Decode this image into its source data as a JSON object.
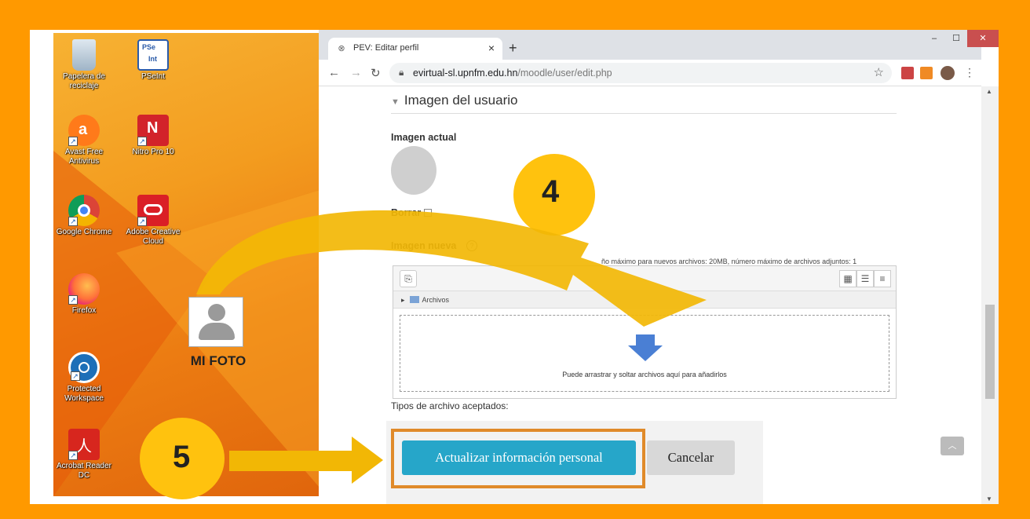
{
  "desktop": {
    "icons": [
      {
        "label": "Papelera de reciclaje",
        "icon": "recycle-bin-icon"
      },
      {
        "label": "PSeInt",
        "icon": "pseint-icon"
      },
      {
        "label": "Avast Free Antivirus",
        "icon": "avast-icon"
      },
      {
        "label": "Nitro Pro 10",
        "icon": "nitro-icon"
      },
      {
        "label": "Google Chrome",
        "icon": "chrome-icon"
      },
      {
        "label": "Adobe Creative Cloud",
        "icon": "creative-cloud-icon"
      },
      {
        "label": "Firefox",
        "icon": "firefox-icon"
      },
      {
        "label": "Protected Workspace",
        "icon": "protected-workspace-icon"
      },
      {
        "label": "Acrobat Reader DC",
        "icon": "acrobat-icon"
      }
    ],
    "file": {
      "label": "MI FOTO",
      "icon": "user-photo-icon"
    }
  },
  "browser": {
    "tab_title": "PEV: Editar perfil",
    "new_tab": "+",
    "url_host": "evirtual-sl.upnfm.edu.hn",
    "url_path": "/moodle/user/edit.php"
  },
  "page": {
    "section_title": "Imagen del usuario",
    "current_image_label": "Imagen actual",
    "delete_label": "Borrar",
    "new_image_label": "Imagen nueva",
    "max_info": "ño máximo para nuevos archivos: 20MB, número máximo de archivos adjuntos: 1",
    "path_label": "Archivos",
    "drop_text": "Puede arrastrar y soltar archivos aquí para añadirlos",
    "file_types": "Tipos de archivo aceptados:",
    "submit_label": "Actualizar información personal",
    "cancel_label": "Cancelar"
  },
  "annotations": {
    "step4": "4",
    "step5": "5"
  },
  "colors": {
    "frame": "#ff9900",
    "badge": "#ffc20e",
    "arrow": "#f2b705",
    "submit": "#26a6c9",
    "highlight": "#e08a2a"
  }
}
